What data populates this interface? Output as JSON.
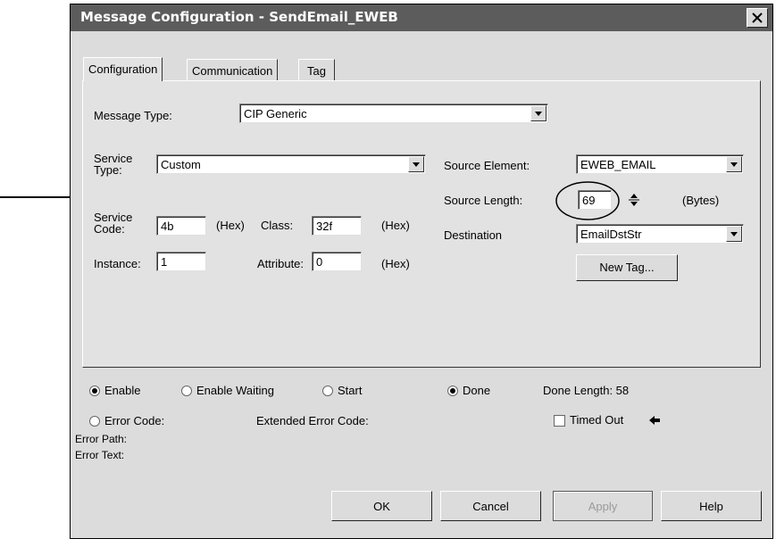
{
  "window": {
    "title": "Message Configuration - SendEmail_EWEB"
  },
  "tabs": [
    {
      "label": "Configuration",
      "active": true
    },
    {
      "label": "Communication",
      "active": false
    },
    {
      "label": "Tag",
      "active": false
    }
  ],
  "config": {
    "message_type_label": "Message Type:",
    "message_type_value": "CIP Generic",
    "service_type_label_1": "Service",
    "service_type_label_2": "Type:",
    "service_type_value": "Custom",
    "service_code_label_1": "Service",
    "service_code_label_2": "Code:",
    "service_code_value": "4b",
    "hex_label": "(Hex)",
    "class_label": "Class:",
    "class_value": "32f",
    "instance_label": "Instance:",
    "instance_value": "1",
    "attribute_label": "Attribute:",
    "attribute_value": "0",
    "source_element_label": "Source Element:",
    "source_element_value": "EWEB_EMAIL",
    "source_length_label": "Source Length:",
    "source_length_value": "69",
    "bytes_label": "(Bytes)",
    "destination_label": "Destination",
    "destination_value": "EmailDstStr",
    "new_tag_label": "New Tag..."
  },
  "status": {
    "enable": "Enable",
    "enable_waiting": "Enable Waiting",
    "start": "Start",
    "done": "Done",
    "done_length": "Done Length: 58",
    "error_code": "Error Code:",
    "extended_error_code": "Extended Error Code:",
    "timed_out": "Timed Out",
    "error_path": "Error Path:",
    "error_text": "Error Text:"
  },
  "buttons": {
    "ok": "OK",
    "cancel": "Cancel",
    "apply": "Apply",
    "help": "Help"
  },
  "colors": {
    "titlebar": "#5c5c5c",
    "dialog_bg": "#dcdcdc"
  }
}
